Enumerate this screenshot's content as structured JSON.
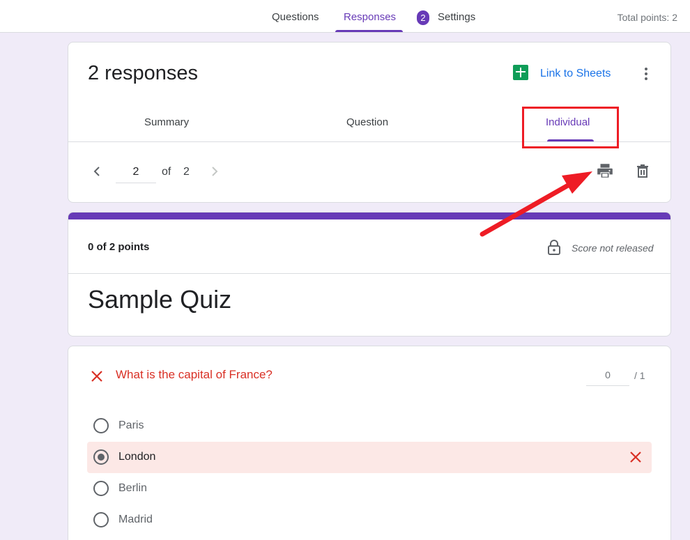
{
  "topbar": {
    "tabs": [
      {
        "label": "Questions"
      },
      {
        "label": "Responses",
        "badge": "2"
      },
      {
        "label": "Settings"
      }
    ],
    "total_points": "Total points: 2"
  },
  "responses_card": {
    "title": "2 responses",
    "link_sheets": "Link to Sheets",
    "tabs": [
      "Summary",
      "Question",
      "Individual"
    ],
    "active_tab": "Individual",
    "pager": {
      "current": "2",
      "of_label": "of",
      "total": "2"
    }
  },
  "score_card": {
    "points": "0 of 2 points",
    "status": "Score not released",
    "quiz_title": "Sample Quiz"
  },
  "question_card": {
    "question": "What is the capital of France?",
    "score_value": "0",
    "score_max": "/ 1",
    "options": [
      {
        "label": "Paris",
        "selected": false
      },
      {
        "label": "London",
        "selected": true,
        "marked_wrong": true
      },
      {
        "label": "Berlin",
        "selected": false
      },
      {
        "label": "Madrid",
        "selected": false
      }
    ]
  },
  "colors": {
    "accent": "#673ab7",
    "background": "#f0ebf8",
    "wrong": "#d93025",
    "link": "#1a73e8",
    "sheets_green": "#0f9d58",
    "annotation_red": "#ee1c25",
    "selected_wrong_bg": "#fce8e6"
  },
  "icons": {
    "sheets": "google-sheets-icon",
    "more": "more-vert-icon",
    "prev": "chevron-left-icon",
    "next": "chevron-right-icon",
    "print": "print-icon",
    "delete": "trash-icon",
    "lock": "lock-icon",
    "wrong": "close-x-icon"
  }
}
